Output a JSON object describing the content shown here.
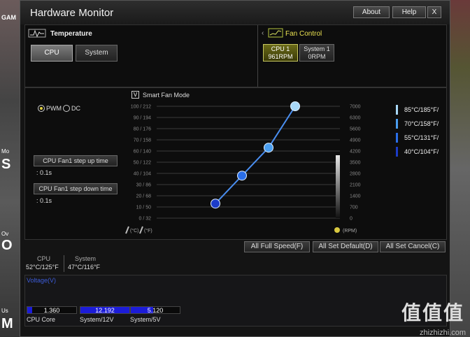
{
  "window": {
    "title": "Hardware Monitor",
    "about": "About",
    "help": "Help",
    "close": "X"
  },
  "bg": {
    "left_letters": [
      "GAM",
      "S",
      "O",
      "M"
    ],
    "left_small": [
      "Mo",
      "Ov",
      "Us"
    ]
  },
  "temperature": {
    "title": "Temperature",
    "tabs": [
      "CPU",
      "System"
    ],
    "selected": "CPU"
  },
  "fan_control": {
    "title": "Fan Control",
    "fans": [
      {
        "name": "CPU 1",
        "rpm": "961RPM",
        "selected": true
      },
      {
        "name": "System 1",
        "rpm": "0RPM",
        "selected": false
      }
    ]
  },
  "mode": {
    "pwm": "PWM",
    "dc": "DC",
    "selected": "PWM"
  },
  "step_up": {
    "label": "CPU Fan1 step up time",
    "value": ": 0.1s"
  },
  "step_down": {
    "label": "CPU Fan1 step down time",
    "value": ": 0.1s"
  },
  "smart_fan": {
    "label": "Smart Fan Mode",
    "checked": true,
    "check": "V"
  },
  "chart_data": {
    "type": "line",
    "y_left_ticks": [
      "100 / 212",
      "90 / 194",
      "80 / 176",
      "70 / 158",
      "60 / 140",
      "50 / 122",
      "40 / 104",
      "30 / 86",
      "20 / 68",
      "10 / 50",
      "0 / 32"
    ],
    "y_right_ticks": [
      "7000",
      "6300",
      "5600",
      "4900",
      "4200",
      "3500",
      "2800",
      "2100",
      "1400",
      "700",
      "0"
    ],
    "x_units": [
      "(°C)",
      "(°F)"
    ],
    "rpm_unit": "(RPM)",
    "points": [
      {
        "temp_c": 40,
        "fan_pct": 13
      },
      {
        "temp_c": 55,
        "fan_pct": 38
      },
      {
        "temp_c": 70,
        "fan_pct": 63
      },
      {
        "temp_c": 85,
        "fan_pct": 100
      }
    ],
    "legend": [
      {
        "temp": "85°C/185°F/",
        "pct": "100%",
        "color": "#a8d8f8"
      },
      {
        "temp": "70°C/158°F/",
        "pct": "63%",
        "color": "#4a9ef0"
      },
      {
        "temp": "55°C/131°F/",
        "pct": "38%",
        "color": "#2a6ee8"
      },
      {
        "temp": "40°C/104°F/",
        "pct": "13%",
        "color": "#1c3cc8"
      }
    ]
  },
  "actions": {
    "full_speed": "All Full Speed(F)",
    "set_default": "All Set Default(D)",
    "set_cancel": "All Set Cancel(C)"
  },
  "readouts": [
    {
      "name": "CPU",
      "value": "52°C/125°F"
    },
    {
      "name": "System",
      "value": "47°C/116°F"
    }
  ],
  "voltage": {
    "title": "Voltage(V)",
    "items": [
      {
        "name": "CPU Core",
        "value": "1.360",
        "fill": 0.1
      },
      {
        "name": "System/12V",
        "value": "12.192",
        "fill": 1.0
      },
      {
        "name": "System/5V",
        "value": "5.120",
        "fill": 0.45
      }
    ]
  },
  "watermark": {
    "big": "值值值",
    "url": "zhizhizhi.com"
  }
}
